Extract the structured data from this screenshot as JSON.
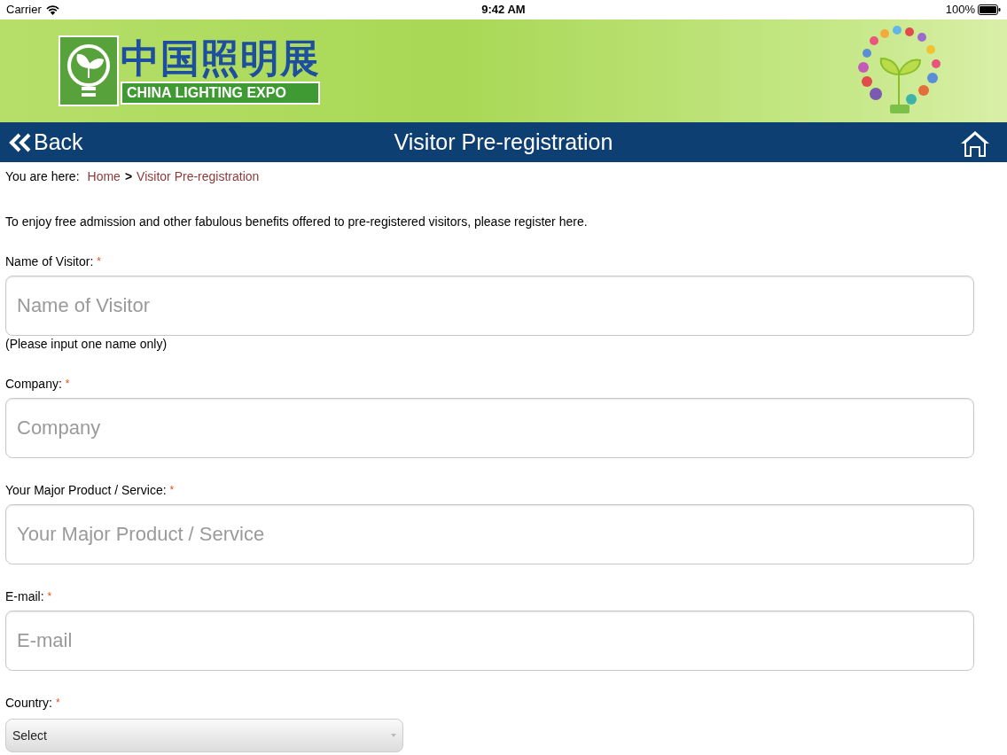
{
  "status_bar": {
    "carrier": "Carrier",
    "time": "9:42 AM",
    "battery": "100%"
  },
  "banner": {
    "logo_chinese": "中国照明展",
    "logo_english": "CHINA LIGHTING EXPO"
  },
  "nav_bar": {
    "back": "Back",
    "title": "Visitor Pre-registration"
  },
  "breadcrumb": {
    "prefix": "You are here:",
    "items": [
      {
        "label": "Home"
      },
      {
        "label": "Visitor Pre-registration"
      }
    ],
    "separator": ">"
  },
  "intro": "To enjoy free admission and other fabulous benefits offered to pre-registered visitors, please register here.",
  "fields": [
    {
      "kind": "text",
      "label": "Name of Visitor:",
      "required": "*",
      "placeholder": "Name of Visitor",
      "hint": "(Please input one name only)"
    },
    {
      "kind": "text",
      "label": "Company:",
      "required": "*",
      "placeholder": "Company"
    },
    {
      "kind": "text",
      "label": "Your Major Product / Service:",
      "required": "*",
      "placeholder": "Your Major Product / Service"
    },
    {
      "kind": "text",
      "label": "E-mail:",
      "required": "*",
      "placeholder": "E-mail"
    },
    {
      "kind": "select",
      "label": "Country:",
      "required": "*",
      "value": "Select"
    }
  ]
}
